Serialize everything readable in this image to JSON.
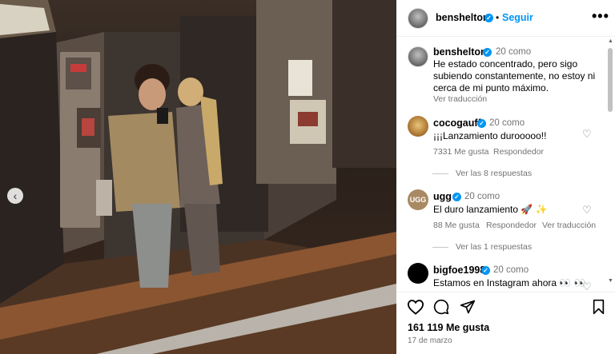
{
  "header": {
    "username": "benshelton",
    "separator": "•",
    "follow_label": "Seguir",
    "more_label": "•••"
  },
  "caption": {
    "username": "benshelton",
    "age": "20 como",
    "text": "He estado concentrado, pero sigo subiendo constantemente, no estoy ni cerca de mi punto máximo.",
    "translate_label": "Ver traducción"
  },
  "comments": [
    {
      "username": "cocogauff",
      "age": "20 como",
      "text": "¡¡¡Lanzamiento durooooo!!",
      "likes": "7331 Me gusta",
      "reply_label": "Respondedor",
      "translate_label": "",
      "view_replies": "Ver las 8 respuestas"
    },
    {
      "username": "ugg",
      "avatar_text": "UGG",
      "age": "20 como",
      "text": "El duro lanzamiento 🚀 ✨",
      "likes": "88 Me gusta",
      "reply_label": "Respondedor",
      "translate_label": "Ver traducción",
      "view_replies": "Ver las 1 respuestas"
    },
    {
      "username": "bigfoe1998",
      "age": "20 como",
      "text": "Estamos en Instagram ahora 👀 👀"
    }
  ],
  "actions": {
    "likes": "161 119 Me gusta",
    "date": "17 de marzo"
  },
  "colors": {
    "accent": "#0095f6",
    "secondary_text": "#737373"
  }
}
